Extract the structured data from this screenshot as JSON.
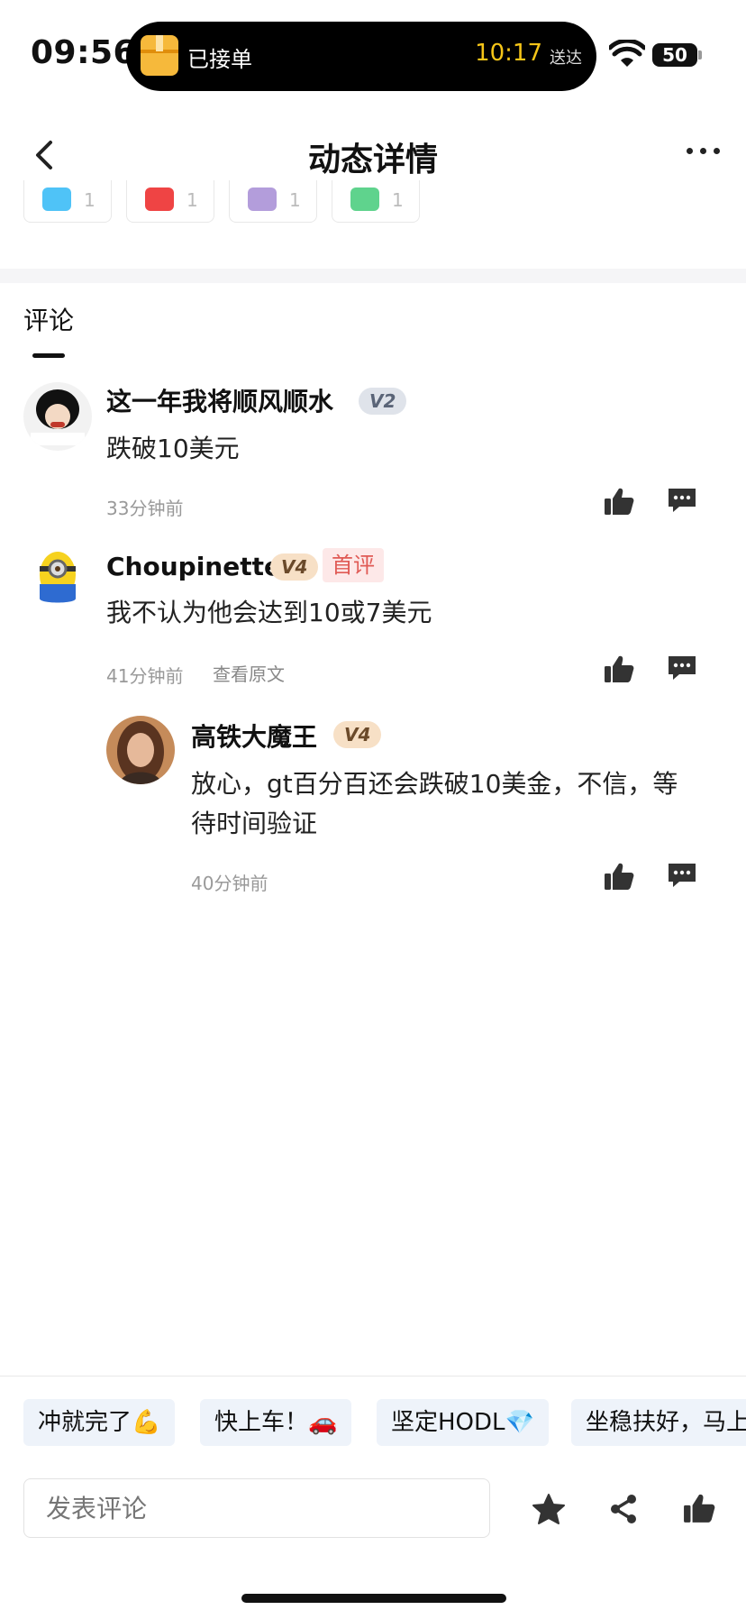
{
  "status_bar": {
    "time": "09:56",
    "island_text": "已接单",
    "eta_time": "10:17",
    "eta_suffix": "送达",
    "battery": "50"
  },
  "header": {
    "title": "动态详情"
  },
  "reactions": [
    {
      "icon": "hodl-face-icon",
      "count": "1",
      "color": "#4fc3f7"
    },
    {
      "icon": "red-face-icon",
      "count": "1",
      "color": "#ef4444"
    },
    {
      "icon": "purple-face-icon",
      "count": "1",
      "color": "#b39ddb"
    },
    {
      "icon": "green-face-icon",
      "count": "1",
      "color": "#5fd38d"
    }
  ],
  "comments_tab": "评论",
  "comments": [
    {
      "user": "这一年我将顺风顺水",
      "level": "V2",
      "text": "跌破10美元",
      "time": "33分钟前"
    },
    {
      "user": "Choupinette",
      "level": "V4",
      "tag": "首评",
      "text": "我不认为他会达到10或7美元",
      "time": "41分钟前",
      "view_original": "查看原文"
    },
    {
      "user": "高铁大魔王",
      "level": "V4",
      "text_line1": "放心，gt百分百还会跌破10美金，不信，等",
      "text_line2": "待时间验证",
      "time": "40分钟前"
    }
  ],
  "quick_replies": [
    "冲就完了💪",
    "快上车！🚗",
    "坚定HODL💎",
    "坐稳扶好，马上"
  ],
  "input": {
    "placeholder": "发表评论"
  },
  "colors": {
    "accent_red": "#e05a55",
    "chip_bg": "#eef3fa"
  }
}
